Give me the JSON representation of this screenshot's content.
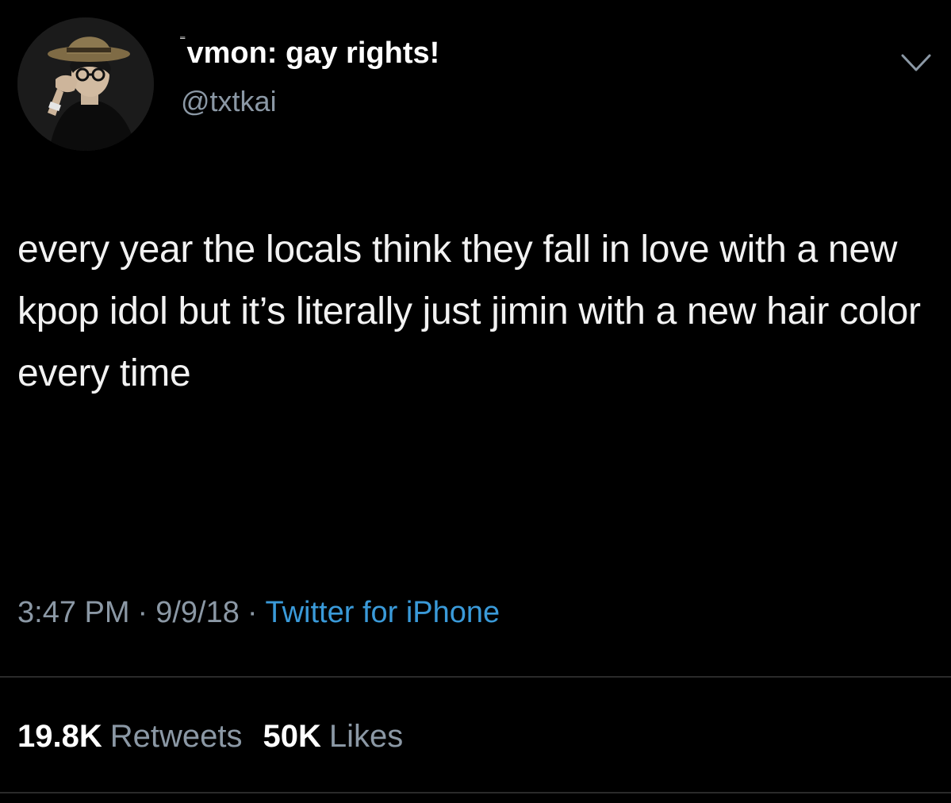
{
  "user": {
    "name_prefix": "⁼",
    "display_name": "vmon: gay rights!",
    "handle": "@txtkai"
  },
  "tweet": {
    "text": "every year the locals think they fall in love with a new kpop idol but it’s literally just jimin with a new hair color every time",
    "time": "3:47 PM",
    "date": "9/9/18",
    "separator": "·",
    "source": "Twitter for iPhone"
  },
  "stats": {
    "retweets_count": "19.8K",
    "retweets_label": "Retweets",
    "likes_count": "50K",
    "likes_label": "Likes"
  },
  "icons": {
    "avatar": "avatar-photo",
    "menu": "chevron-down-icon"
  },
  "colors": {
    "background": "#000000",
    "text": "#ffffff",
    "secondary": "#8b98a5",
    "link": "#3a9ad9",
    "divider": "#2a2a2a"
  }
}
